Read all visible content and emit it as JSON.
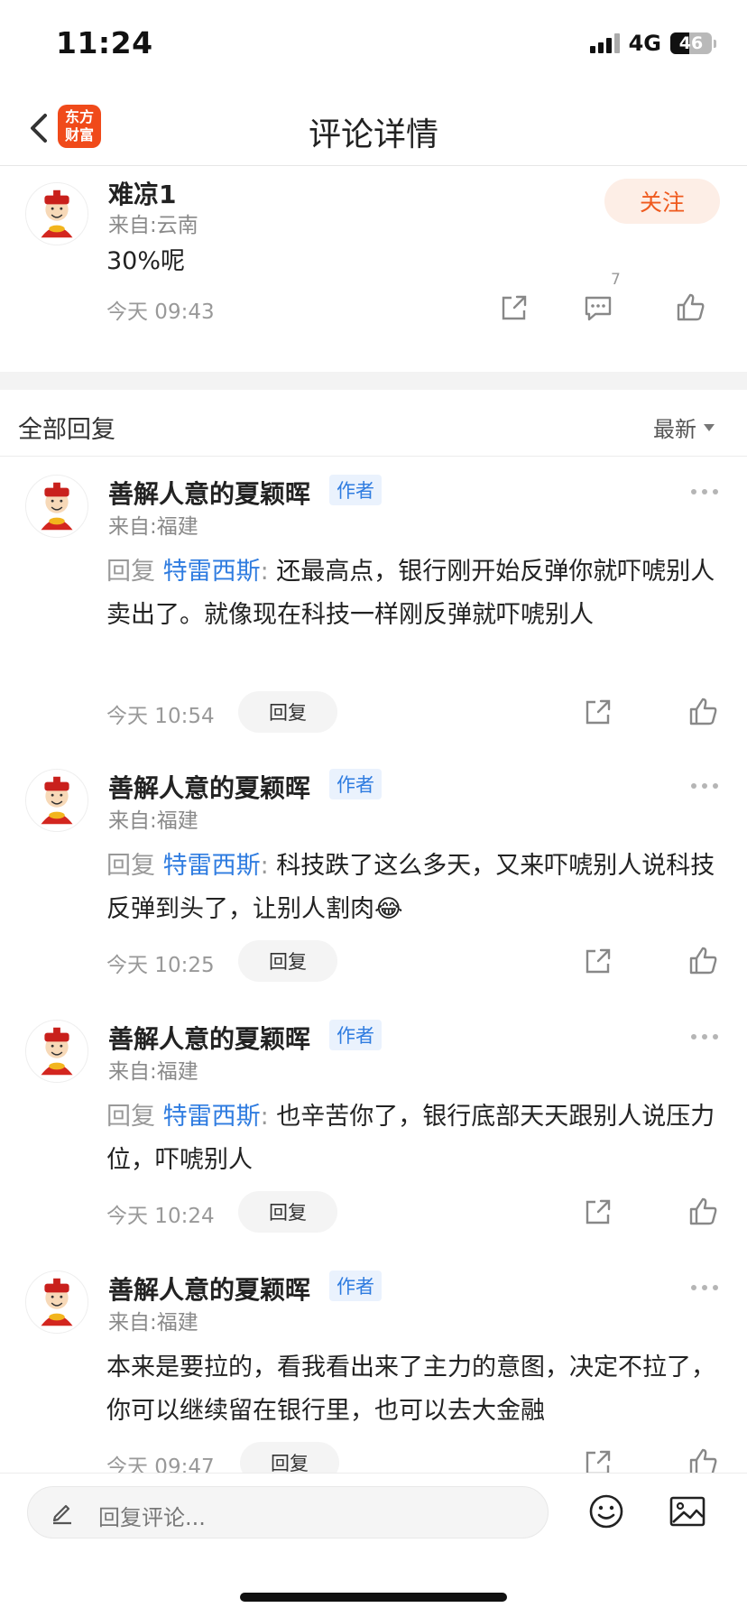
{
  "status_bar": {
    "time": "11:24",
    "network": "4G",
    "battery": "46"
  },
  "nav": {
    "title": "评论详情",
    "logo_text": "东方财富"
  },
  "main_comment": {
    "user": "难凉1",
    "location": "来自:云南",
    "follow_label": "关注",
    "text": "30%呢",
    "time": "今天 09:43",
    "comment_count": "7"
  },
  "section": {
    "title": "全部回复",
    "sort_label": "最新"
  },
  "replies": [
    {
      "user": "善解人意的夏颖晖",
      "tag": "作者",
      "location": "来自:福建",
      "prefix": "回复",
      "mention": "特雷西斯",
      "colon": ":",
      "text": "还最高点，银行刚开始反弹你就吓唬别人卖出了。就像现在科技一样刚反弹就吓唬别人",
      "time": "今天 10:54",
      "reply_label": "回复"
    },
    {
      "user": "善解人意的夏颖晖",
      "tag": "作者",
      "location": "来自:福建",
      "prefix": "回复",
      "mention": "特雷西斯",
      "colon": ":",
      "text": "科技跌了这么多天，又来吓唬别人说科技反弹到头了，让别人割肉😂",
      "time": "今天 10:25",
      "reply_label": "回复"
    },
    {
      "user": "善解人意的夏颖晖",
      "tag": "作者",
      "location": "来自:福建",
      "prefix": "回复",
      "mention": "特雷西斯",
      "colon": ":",
      "text": "也辛苦你了，银行底部天天跟别人说压力位，吓唬别人",
      "time": "今天 10:24",
      "reply_label": "回复"
    },
    {
      "user": "善解人意的夏颖晖",
      "tag": "作者",
      "location": "来自:福建",
      "text": "本来是要拉的，看我看出来了主力的意图，决定不拉了，你可以继续留在银行里，也可以去大金融",
      "time": "今天 09:47",
      "reply_label": "回复"
    }
  ],
  "bottom_bar": {
    "input_placeholder": "回复评论..."
  },
  "colors": {
    "accent": "#ef5a1e",
    "link": "#2f7ce0",
    "brand": "#f04a1a"
  }
}
